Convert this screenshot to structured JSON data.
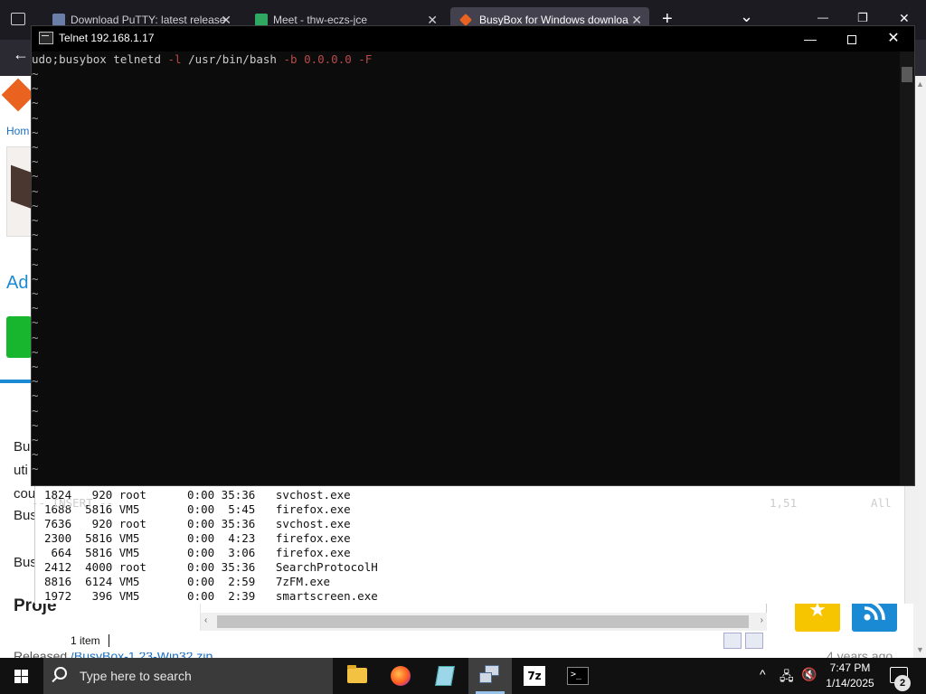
{
  "browser": {
    "tabs": [
      {
        "title": "Download PuTTY: latest release",
        "active": false
      },
      {
        "title": "Meet - thw-eczs-jce",
        "active": false
      },
      {
        "title": "BusyBox for Windows downloa",
        "active": true
      }
    ],
    "new_tab": "+",
    "tab_list": "⌄",
    "window_controls": {
      "minimize": "—",
      "restore": "❐",
      "close": "✕"
    },
    "back": "←"
  },
  "page": {
    "breadcrumb": "Hom",
    "ad_title": "Ad",
    "body_lines": [
      "Bu",
      "uti",
      "cou",
      "Bus",
      "Bus"
    ],
    "project_heading": "Proje",
    "released_prefix": "Released",
    "released_link": "/BusyBox-1.23-Win32.zip",
    "released_ago": "4 years ago",
    "colors": {
      "accent_blue": "#1a8ad4",
      "logo_orange": "#e9621f",
      "green": "#18b52e",
      "star_yellow": "#f7c400"
    }
  },
  "processes": [
    {
      "pid": "1824",
      "vsz": "920",
      "user": "root",
      "time": "0:00",
      "cpu": "35:36",
      "cmd": "svchost.exe"
    },
    {
      "pid": "1688",
      "vsz": "5816",
      "user": "VM5",
      "time": "0:00",
      "cpu": "5:45",
      "cmd": "firefox.exe"
    },
    {
      "pid": "7636",
      "vsz": "920",
      "user": "root",
      "time": "0:00",
      "cpu": "35:36",
      "cmd": "svchost.exe"
    },
    {
      "pid": "2300",
      "vsz": "5816",
      "user": "VM5",
      "time": "0:00",
      "cpu": "4:23",
      "cmd": "firefox.exe"
    },
    {
      "pid": "664",
      "vsz": "5816",
      "user": "VM5",
      "time": "0:00",
      "cpu": "3:06",
      "cmd": "firefox.exe"
    },
    {
      "pid": "2412",
      "vsz": "4000",
      "user": "root",
      "time": "0:00",
      "cpu": "35:36",
      "cmd": "SearchProtocolH"
    },
    {
      "pid": "8816",
      "vsz": "6124",
      "user": "VM5",
      "time": "0:00",
      "cpu": "2:59",
      "cmd": "7zFM.exe"
    },
    {
      "pid": "1972",
      "vsz": "396",
      "user": "VM5",
      "time": "0:00",
      "cpu": "2:39",
      "cmd": "smartscreen.exe"
    }
  ],
  "explorer": {
    "status": "1 item",
    "scroll_left": "‹",
    "scroll_right": "›"
  },
  "telnet": {
    "title": "Telnet 192.168.1.17",
    "controls": {
      "minimize": "—",
      "close": "✕"
    },
    "command": {
      "prefix": "udo;busybox telnetd ",
      "flag1": "-l",
      "path": " /usr/bin/bash ",
      "flag2": "-b",
      "space": " ",
      "ip": "0.0.0.0",
      "space2": " ",
      "flag3": "-F"
    },
    "tilde": "~",
    "tilde_count": 28,
    "mode": "-- INSERT --",
    "cursor_pos": "1,51",
    "view_pos": "All",
    "colors": {
      "bg": "#0c0c0c",
      "text": "#cccccc",
      "flag": "#b94a4a"
    }
  },
  "taskbar": {
    "search_placeholder": "Type here to search",
    "apps": [
      {
        "name": "file-explorer",
        "active": false
      },
      {
        "name": "firefox",
        "active": false
      },
      {
        "name": "notepad",
        "active": false
      },
      {
        "name": "telnet",
        "active": true
      },
      {
        "name": "7-zip",
        "active": false
      },
      {
        "name": "command-prompt",
        "active": false
      }
    ],
    "sevenz_label": "7z",
    "cmd_label": ">_",
    "tray": {
      "chevron": "^",
      "network": "🖧",
      "volume": "🔇"
    },
    "time": "7:47 PM",
    "date": "1/14/2025",
    "notifications": "2"
  }
}
